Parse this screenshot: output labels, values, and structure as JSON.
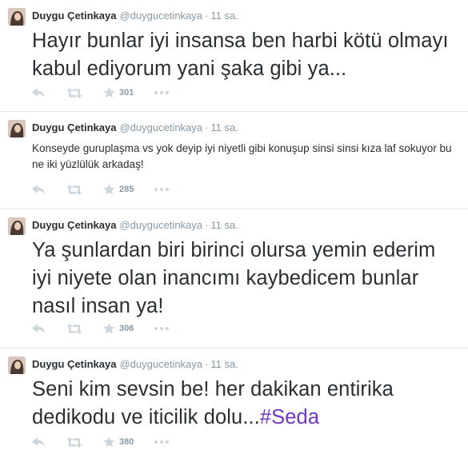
{
  "tweets": [
    {
      "name": "Duygu Çetinkaya",
      "handle": "@duygucetinkaya",
      "separator": "·",
      "time": "11 sa.",
      "text": "Hayır bunlar iyi insansa ben harbi kötü olmayı kabul ediyorum yani şaka gibi ya...",
      "hashtag": "",
      "favorites": "301"
    },
    {
      "name": "Duygu Çetinkaya",
      "handle": "@duygucetinkaya",
      "separator": "·",
      "time": "11 sa.",
      "text": "Konseyde guruplaşma vs yok deyip iyi niyetli gibi konuşup sinsi sinsi kıza laf sokuyor bu ne iki yüzlülük arkadaş!",
      "hashtag": "",
      "favorites": "285"
    },
    {
      "name": "Duygu Çetinkaya",
      "handle": "@duygucetinkaya",
      "separator": "·",
      "time": "11 sa.",
      "text": "Ya şunlardan biri birinci olursa yemin ederim iyi niyete olan inancımı kaybedicem bunlar nasıl insan ya!",
      "hashtag": "",
      "favorites": "306"
    },
    {
      "name": "Duygu Çetinkaya",
      "handle": "@duygucetinkaya",
      "separator": "·",
      "time": "11 sa.",
      "text": "Seni kim sevsin be! her dakikan entirika dedikodu ve iticilik dolu...",
      "hashtag": "#Seda",
      "favorites": "380"
    }
  ],
  "icons": {
    "reply": "reply-icon",
    "retweet": "retweet-icon",
    "favorite": "star-icon",
    "more": "more-icon"
  },
  "colors": {
    "hashtag": "#6e35c7",
    "meta": "#8899a6",
    "icon": "#ccd6dd",
    "text": "#292f33"
  }
}
